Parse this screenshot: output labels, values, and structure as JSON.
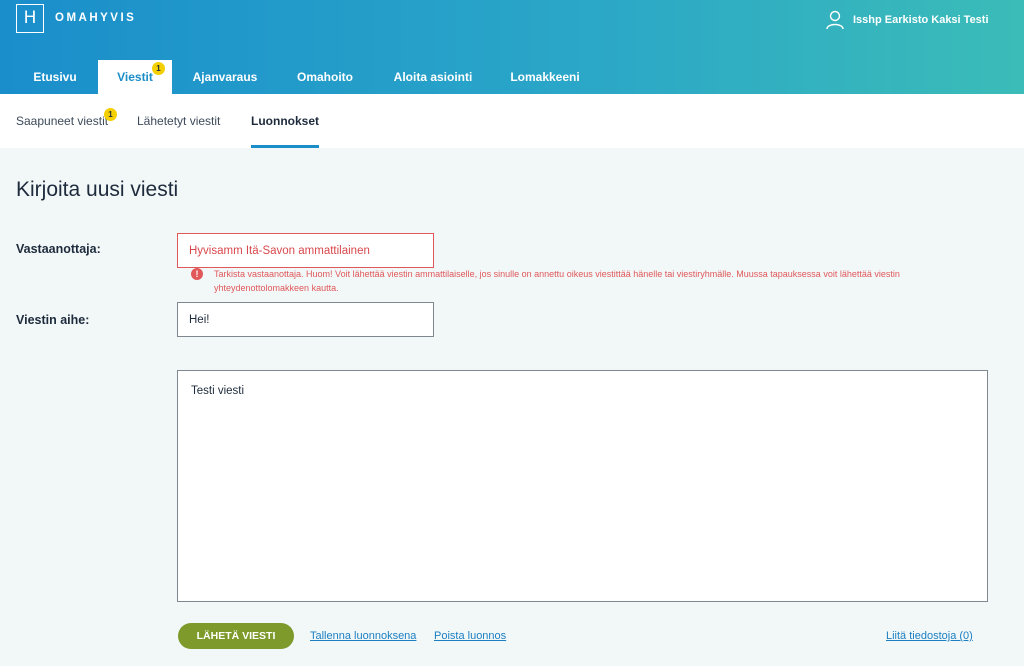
{
  "app": {
    "logo_letter": "H",
    "name": "OMAHYVIS"
  },
  "user": {
    "name": "Isshp Earkisto Kaksi Testi",
    "icon": "user-icon"
  },
  "nav": {
    "items": [
      {
        "label": "Etusivu"
      },
      {
        "label": "Viestit",
        "badge": "1",
        "active": true
      },
      {
        "label": "Ajanvaraus"
      },
      {
        "label": "Omahoito"
      },
      {
        "label": "Aloita asiointi"
      },
      {
        "label": "Lomakkeeni"
      }
    ]
  },
  "subnav": {
    "items": [
      {
        "label": "Saapuneet viestit",
        "badge": "1"
      },
      {
        "label": "Lähetetyt viestit"
      },
      {
        "label": "Luonnokset",
        "active": true
      }
    ]
  },
  "page": {
    "title": "Kirjoita uusi viesti"
  },
  "form": {
    "recipient_label": "Vastaanottaja:",
    "recipient_value": "Hyvisamm Itä-Savon ammattilainen",
    "recipient_error_icon": "!",
    "recipient_error": "Tarkista vastaanottaja. Huom! Voit lähettää viestin ammattilaiselle, jos sinulle on annettu oikeus viestittää hänelle tai viestiryhmälle. Muussa tapauksessa voit lähettää viestin yhteydenottolomakkeen kautta.",
    "subject_label": "Viestin aihe:",
    "subject_value": "Hei!",
    "body_value": "Testi viesti"
  },
  "actions": {
    "send": "LÄHETÄ VIESTI",
    "save_draft": "Tallenna luonnoksena",
    "delete_draft": "Poista luonnos",
    "attach": "Liitä tiedostoja (0)"
  },
  "colors": {
    "primary": "#1b8ec9",
    "accent_green": "#7d9a2a",
    "error": "#e0585a",
    "badge": "#f5d000"
  }
}
